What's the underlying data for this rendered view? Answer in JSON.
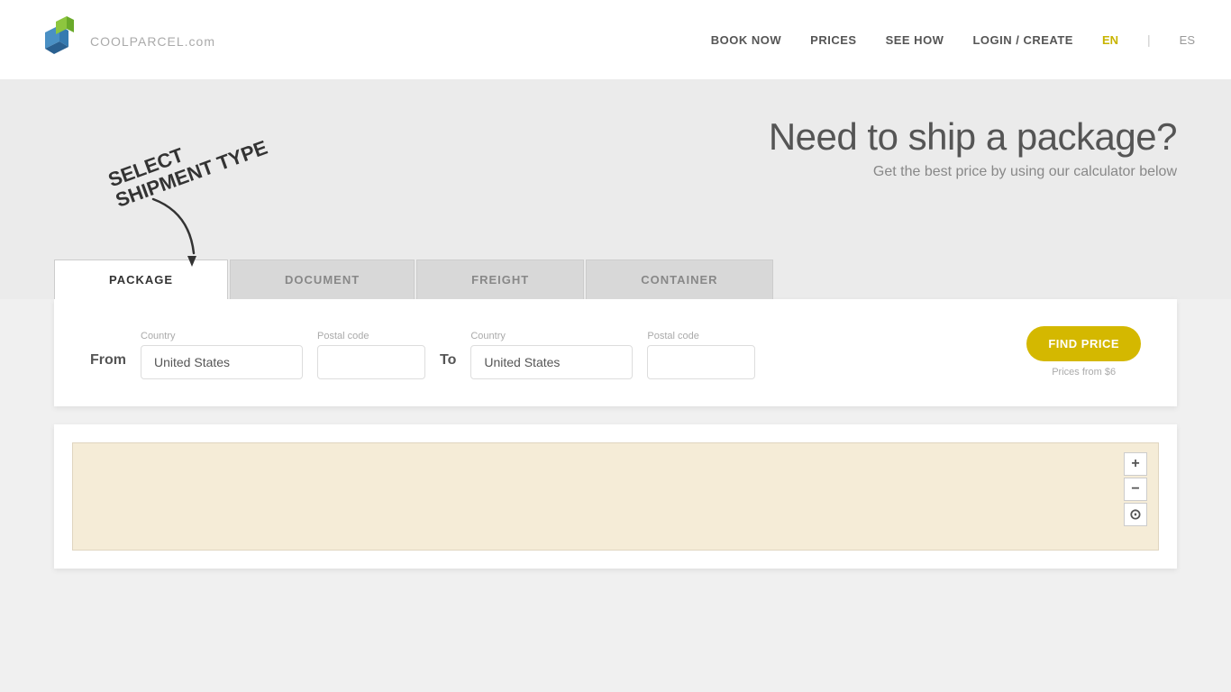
{
  "header": {
    "logo_text": "COOLPARCEL",
    "logo_suffix": ".com",
    "nav": {
      "book_now": "BOOK NOW",
      "prices": "PRICES",
      "see_how": "SEE HOW",
      "login_create": "LOGIN / CREATE",
      "lang_en": "EN",
      "lang_es": "ES"
    }
  },
  "hero": {
    "annotation_line1": "SELECT",
    "annotation_line2": "SHIPMENT TYPE",
    "title": "Need to ship a package?",
    "subtitle": "Get the best price by using our calculator below"
  },
  "tabs": [
    {
      "id": "package",
      "label": "PACKAGE",
      "active": true
    },
    {
      "id": "document",
      "label": "DOCUMENT",
      "active": false
    },
    {
      "id": "freight",
      "label": "FREIGHT",
      "active": false
    },
    {
      "id": "container",
      "label": "CONTAINER",
      "active": false
    }
  ],
  "calculator": {
    "from_label": "From",
    "to_label": "To",
    "from_country_label": "Country",
    "from_country_value": "United States",
    "from_postal_label": "Postal code",
    "from_postal_value": "",
    "to_country_label": "Country",
    "to_country_value": "United States",
    "to_postal_label": "Postal code",
    "to_postal_value": "",
    "find_price_btn": "FIND PRICE",
    "prices_from": "Prices from $6"
  },
  "map": {
    "zoom_in": "+",
    "zoom_out": "−",
    "reset": "⊙"
  }
}
